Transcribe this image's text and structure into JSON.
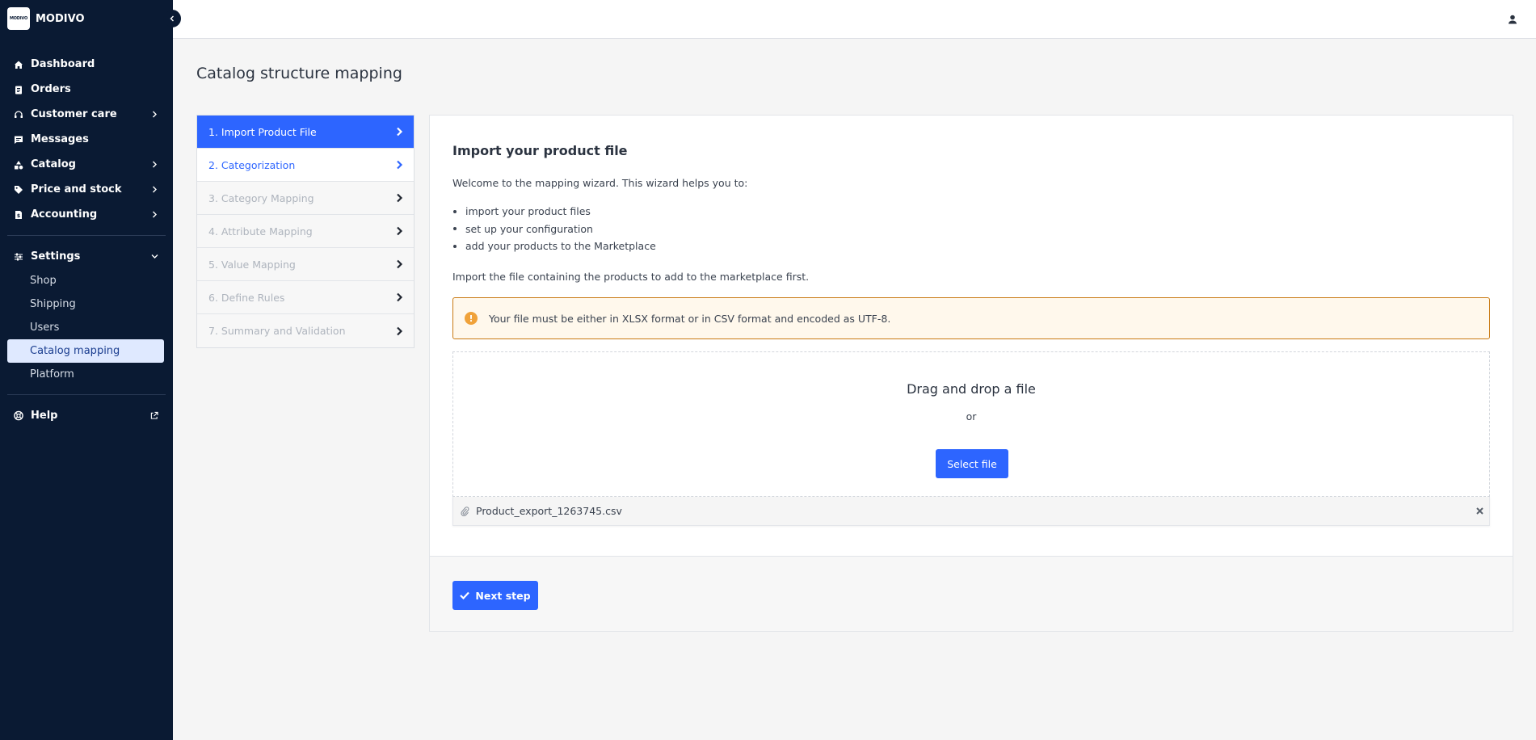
{
  "brand": {
    "logo_text": "MODIVO",
    "name": "MODIVO"
  },
  "sidebar": {
    "items": [
      {
        "label": "Dashboard",
        "icon": "home-icon"
      },
      {
        "label": "Orders",
        "icon": "clipboard-icon"
      },
      {
        "label": "Customer care",
        "icon": "headset-icon"
      },
      {
        "label": "Messages",
        "icon": "chat-icon"
      },
      {
        "label": "Catalog",
        "icon": "shapes-icon"
      },
      {
        "label": "Price and stock",
        "icon": "tag-icon"
      },
      {
        "label": "Accounting",
        "icon": "invoice-icon"
      }
    ],
    "settings": {
      "label": "Settings",
      "icon": "sliders-icon",
      "subitems": [
        "Shop",
        "Shipping",
        "Users",
        "Catalog mapping",
        "Platform"
      ]
    },
    "help": {
      "label": "Help",
      "icon": "lifebuoy-icon"
    }
  },
  "page": {
    "title": "Catalog structure mapping"
  },
  "steps": [
    "1. Import Product File",
    "2. Categorization",
    "3. Category Mapping",
    "4. Attribute Mapping",
    "5. Value Mapping",
    "6. Define Rules",
    "7. Summary and Validation"
  ],
  "card": {
    "title": "Import your product file",
    "intro": "Welcome to the mapping wizard. This wizard helps you to:",
    "bullets": [
      "import your product files",
      "set up your configuration",
      "add your products to the Marketplace"
    ],
    "import_text": "Import the file containing the products to add to the marketplace first.",
    "alert": "Your file must be either in XLSX format or in CSV format and encoded as UTF-8.",
    "dropzone": {
      "title": "Drag and drop a file",
      "or": "or",
      "button": "Select file"
    },
    "file_name": "Product_export_1263745.csv",
    "next_button": "Next step"
  },
  "colors": {
    "sidebar_bg": "#0a1a33",
    "accent": "#2d65ff",
    "alert_border": "#c97a12",
    "alert_bg": "#fff8ec"
  }
}
